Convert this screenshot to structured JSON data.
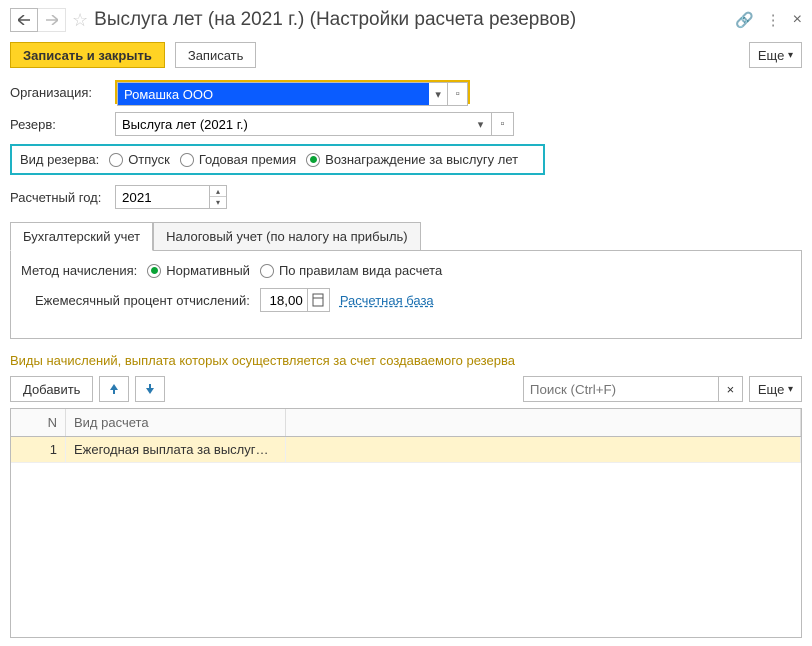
{
  "title": "Выслуга лет (на 2021 г.) (Настройки расчета резервов)",
  "toolbar": {
    "save_close": "Записать и закрыть",
    "save": "Записать",
    "more": "Еще"
  },
  "labels": {
    "org": "Организация:",
    "reserve": "Резерв:",
    "reserve_type": "Вид резерва:",
    "calc_year": "Расчетный год:",
    "method": "Метод начисления:",
    "monthly_pct": "Ежемесячный процент отчислений:",
    "base_link": "Расчетная база",
    "section": "Виды начислений, выплата которых осуществляется за счет создаваемого резерва",
    "add": "Добавить",
    "search_ph": "Поиск (Ctrl+F)"
  },
  "org_value": "Ромашка ООО",
  "reserve_value": "Выслуга лет (2021 г.)",
  "reserve_types": {
    "opt1": "Отпуск",
    "opt2": "Годовая премия",
    "opt3": "Вознаграждение за выслугу лет",
    "selected": "opt3"
  },
  "calc_year": "2021",
  "tabs": {
    "accounting": "Бухгалтерский учет",
    "tax": "Налоговый учет (по налогу на прибыль)",
    "active": "accounting"
  },
  "method_opts": {
    "opt1": "Нормативный",
    "opt2": "По правилам вида расчета",
    "selected": "opt1"
  },
  "monthly_pct_val": "18,00",
  "grid": {
    "col_n": "N",
    "col_type": "Вид расчета",
    "rows": [
      {
        "n": "1",
        "type": "Ежегодная выплата за выслуг…"
      }
    ]
  }
}
